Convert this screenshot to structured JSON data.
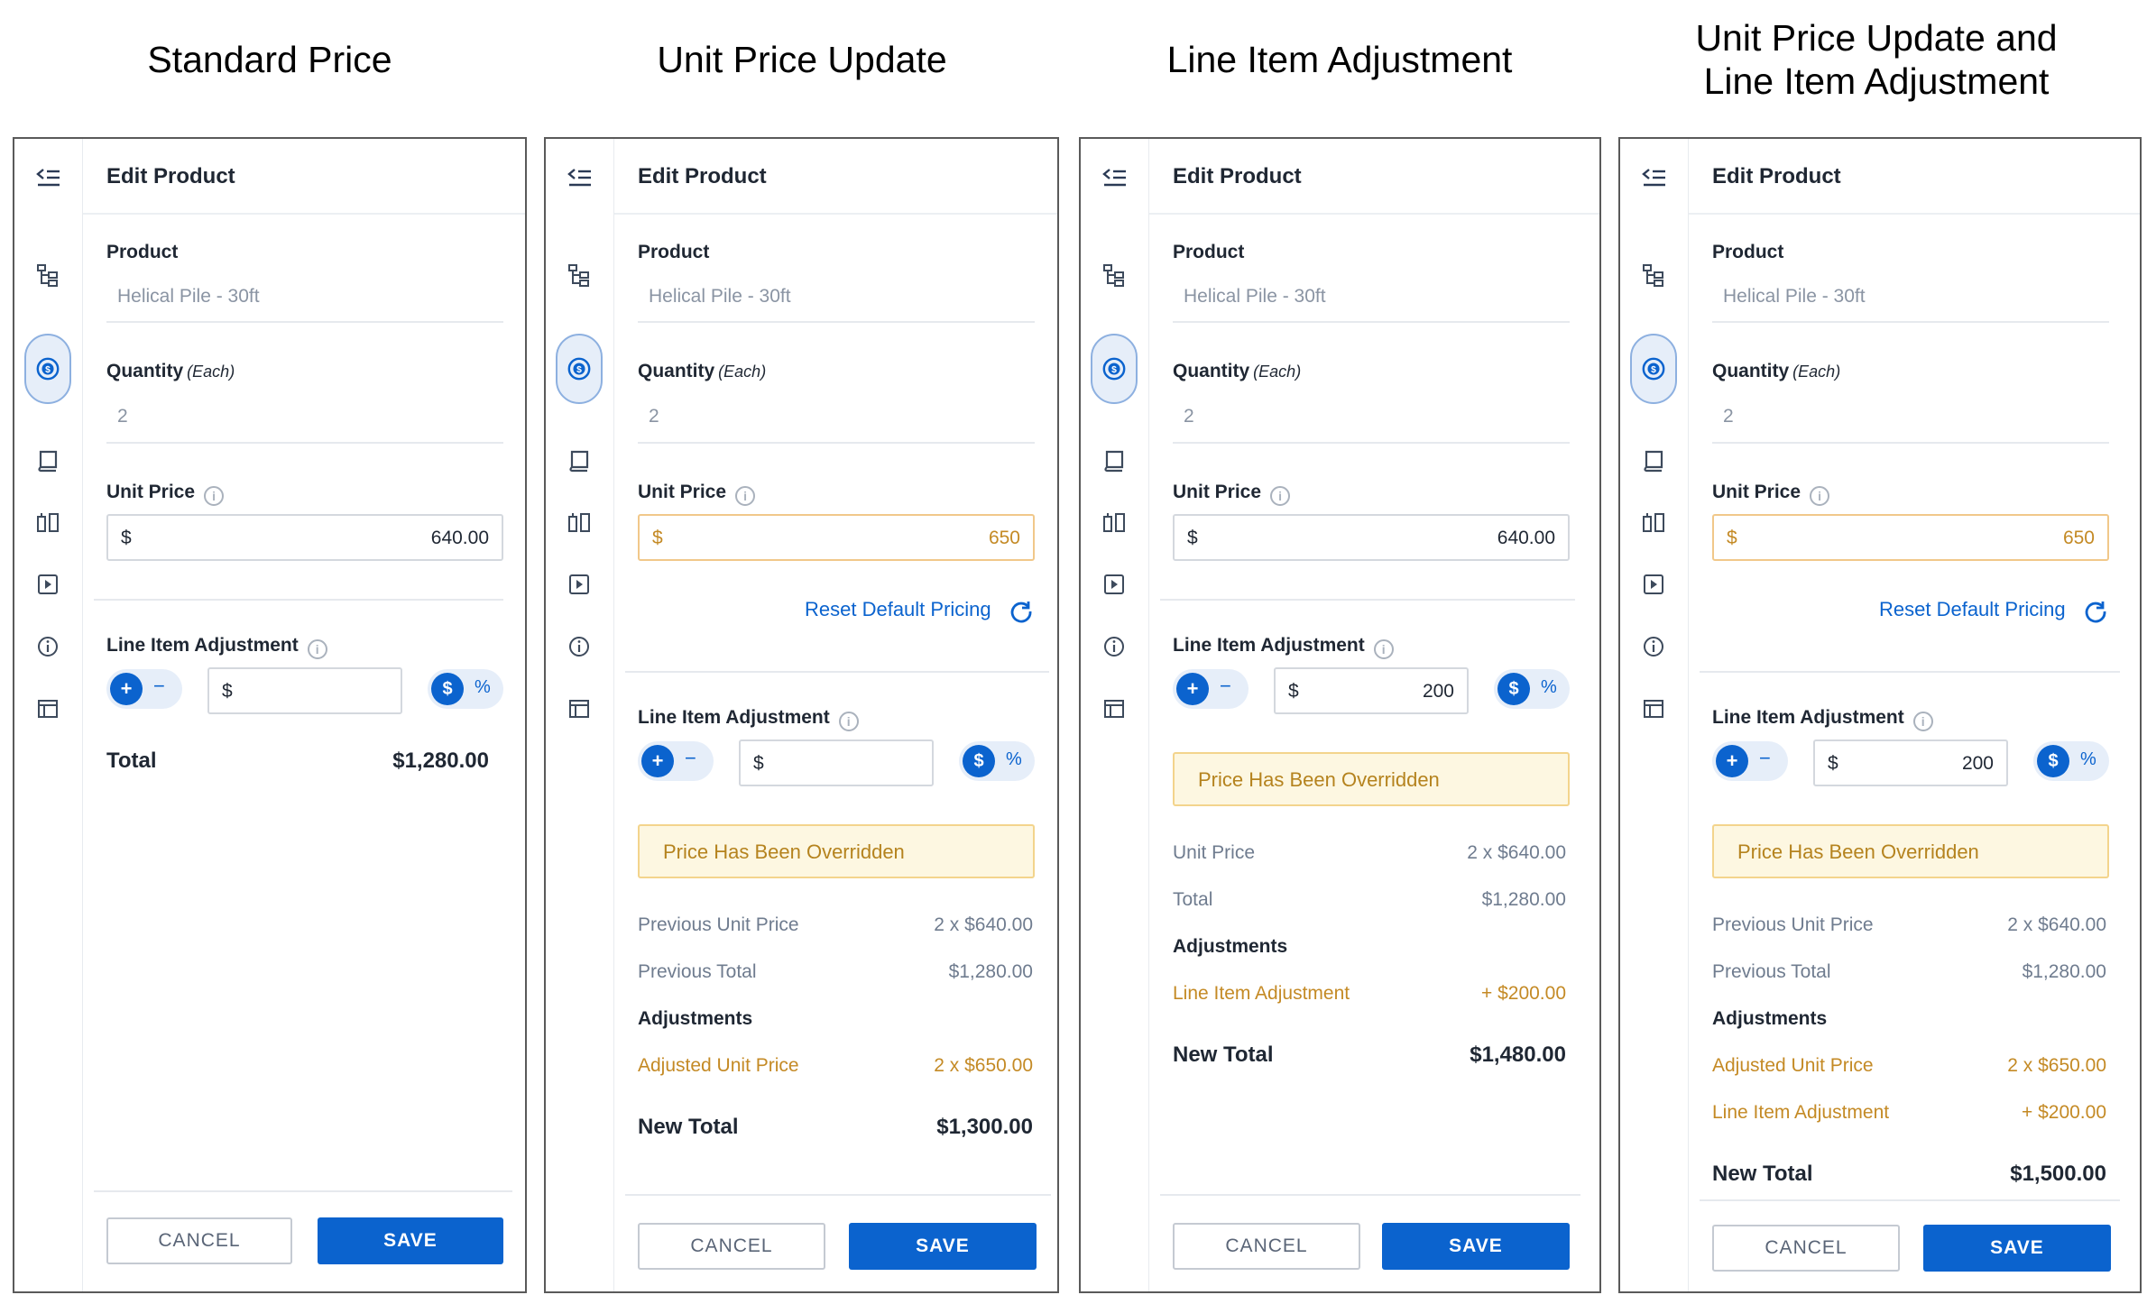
{
  "titles": {
    "col1": "Standard Price",
    "col2": "Unit Price Update",
    "col3": "Line Item Adjustment",
    "col4_line1": "Unit Price Update and",
    "col4_line2": "Line Item Adjustment"
  },
  "common": {
    "header_title": "Edit Product",
    "product_label": "Product",
    "product_value": "Helical Pile - 30ft",
    "quantity_label": "Quantity",
    "quantity_unit": "(Each)",
    "quantity_value": "2",
    "unit_price_label": "Unit Price",
    "line_item_label": "Line Item Adjustment",
    "currency": "$",
    "plus": "+",
    "minus": "−",
    "percent": "%",
    "reset_label": "Reset Default Pricing",
    "banner_text": "Price Has Been Overridden",
    "adjustments_label": "Adjustments",
    "cancel_label": "CANCEL",
    "save_label": "SAVE",
    "info_glyph": "i"
  },
  "panel1": {
    "unit_price_value": "640.00",
    "line_item_value": "",
    "total_label": "Total",
    "total_value": "$1,280.00"
  },
  "panel2": {
    "unit_price_value": "650",
    "line_item_value": "",
    "prev_unit_label": "Previous Unit Price",
    "prev_unit_value": "2 x $640.00",
    "prev_total_label": "Previous Total",
    "prev_total_value": "$1,280.00",
    "adj_unit_label": "Adjusted Unit Price",
    "adj_unit_value": "2 x $650.00",
    "new_total_label": "New Total",
    "new_total_value": "$1,300.00"
  },
  "panel3": {
    "unit_price_value": "640.00",
    "line_item_value": "200",
    "unit_label": "Unit Price",
    "unit_value": "2 x $640.00",
    "total_label": "Total",
    "total_value": "$1,280.00",
    "line_adj_label": "Line Item Adjustment",
    "line_adj_value": "+ $200.00",
    "new_total_label": "New Total",
    "new_total_value": "$1,480.00"
  },
  "panel4": {
    "unit_price_value": "650",
    "line_item_value": "200",
    "prev_unit_label": "Previous Unit Price",
    "prev_unit_value": "2 x $640.00",
    "prev_total_label": "Previous Total",
    "prev_total_value": "$1,280.00",
    "adj_unit_label": "Adjusted Unit Price",
    "adj_unit_value": "2 x $650.00",
    "line_adj_label": "Line Item Adjustment",
    "line_adj_value": "+ $200.00",
    "new_total_label": "New Total",
    "new_total_value": "$1,500.00"
  },
  "colors": {
    "accent": "#0b63ce",
    "warning_text": "#c48a25",
    "warning_bg": "#fdf7e1"
  },
  "icons": [
    "collapse-menu-icon",
    "hierarchy-icon",
    "dollar-icon",
    "notebook-icon",
    "compare-icon",
    "play-icon",
    "info-icon",
    "layout-icon"
  ]
}
